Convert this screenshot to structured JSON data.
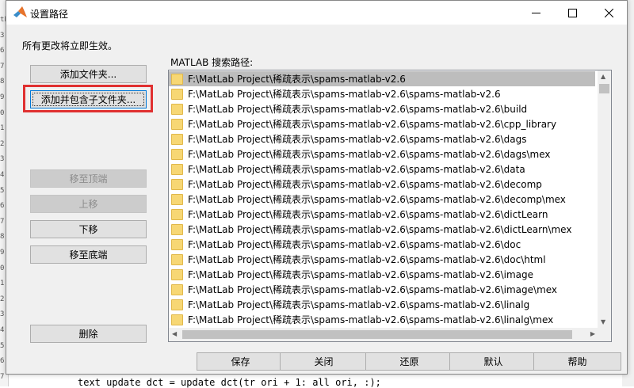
{
  "background": {
    "gutter_numbers": [
      "tL",
      "3",
      "6",
      "7",
      "8",
      "9",
      "0",
      "1",
      "2",
      "3",
      "4",
      "5",
      "6",
      "7",
      "8",
      "9",
      "0",
      "1",
      "2",
      "3",
      "4",
      "5",
      "6",
      "7"
    ],
    "code_line": "text update dct = update dct(tr ori + 1: all ori, :);"
  },
  "window": {
    "title": "设置路径",
    "icon": "matlab-logo-icon",
    "controls": [
      "minimize-icon",
      "maximize-icon",
      "close-icon"
    ]
  },
  "notice": "所有更改将立即生效。",
  "path_label": "MATLAB 搜索路径:",
  "left_buttons": {
    "add_folder": "添加文件夹...",
    "add_with_subfolders": "添加并包含子文件夹...",
    "move_to_top": "移至顶端",
    "move_up": "上移",
    "move_down": "下移",
    "move_to_bottom": "移至底端",
    "remove": "删除"
  },
  "paths": [
    "F:\\MatLab Project\\稀疏表示\\spams-matlab-v2.6",
    "F:\\MatLab Project\\稀疏表示\\spams-matlab-v2.6\\spams-matlab-v2.6",
    "F:\\MatLab Project\\稀疏表示\\spams-matlab-v2.6\\spams-matlab-v2.6\\build",
    "F:\\MatLab Project\\稀疏表示\\spams-matlab-v2.6\\spams-matlab-v2.6\\cpp_library",
    "F:\\MatLab Project\\稀疏表示\\spams-matlab-v2.6\\spams-matlab-v2.6\\dags",
    "F:\\MatLab Project\\稀疏表示\\spams-matlab-v2.6\\spams-matlab-v2.6\\dags\\mex",
    "F:\\MatLab Project\\稀疏表示\\spams-matlab-v2.6\\spams-matlab-v2.6\\data",
    "F:\\MatLab Project\\稀疏表示\\spams-matlab-v2.6\\spams-matlab-v2.6\\decomp",
    "F:\\MatLab Project\\稀疏表示\\spams-matlab-v2.6\\spams-matlab-v2.6\\decomp\\mex",
    "F:\\MatLab Project\\稀疏表示\\spams-matlab-v2.6\\spams-matlab-v2.6\\dictLearn",
    "F:\\MatLab Project\\稀疏表示\\spams-matlab-v2.6\\spams-matlab-v2.6\\dictLearn\\mex",
    "F:\\MatLab Project\\稀疏表示\\spams-matlab-v2.6\\spams-matlab-v2.6\\doc",
    "F:\\MatLab Project\\稀疏表示\\spams-matlab-v2.6\\spams-matlab-v2.6\\doc\\html",
    "F:\\MatLab Project\\稀疏表示\\spams-matlab-v2.6\\spams-matlab-v2.6\\image",
    "F:\\MatLab Project\\稀疏表示\\spams-matlab-v2.6\\spams-matlab-v2.6\\image\\mex",
    "F:\\MatLab Project\\稀疏表示\\spams-matlab-v2.6\\spams-matlab-v2.6\\linalg",
    "F:\\MatLab Project\\稀疏表示\\spams-matlab-v2.6\\spams-matlab-v2.6\\linalg\\mex"
  ],
  "selected_index": 0,
  "bottom_buttons": {
    "save": "保存",
    "close": "关闭",
    "revert": "还原",
    "default": "默认",
    "help": "帮助"
  },
  "colors": {
    "highlight_box": "#e03030",
    "selected_row": "#bdbdbd",
    "folder": "#f7d774"
  }
}
